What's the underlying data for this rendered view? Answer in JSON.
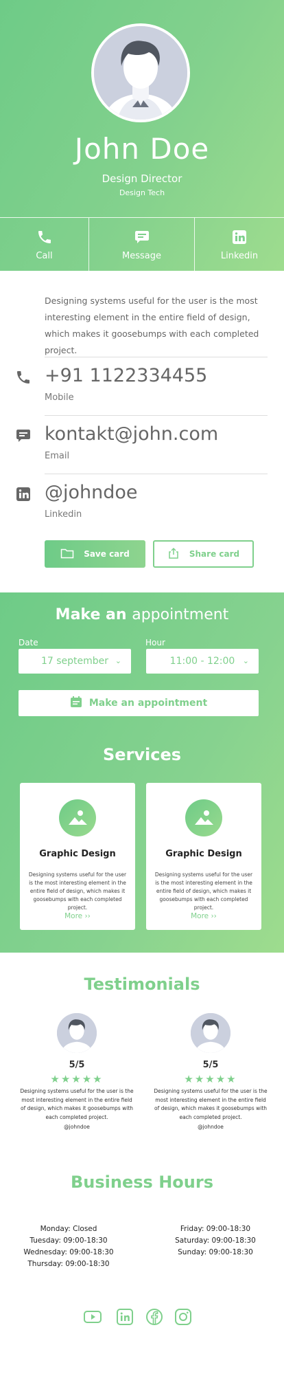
{
  "profile": {
    "name": "John Doe",
    "title": "Design Director",
    "company": "Design Tech"
  },
  "actions": [
    {
      "label": "Call",
      "icon": "phone-icon"
    },
    {
      "label": "Message",
      "icon": "message-icon"
    },
    {
      "label": "Linkedin",
      "icon": "linkedin-icon"
    }
  ],
  "about": "Designing systems useful for the user is the most interesting element in the entire field of design, which makes it goosebumps with each completed project.",
  "contacts": [
    {
      "value": "+91 1122334455",
      "label": "Mobile",
      "icon": "phone-icon"
    },
    {
      "value": "kontakt@john.com",
      "label": "Email",
      "icon": "message-icon"
    },
    {
      "value": "@johndoe",
      "label": "Linkedin",
      "icon": "linkedin-icon"
    }
  ],
  "card_buttons": {
    "save": "Save card",
    "share": "Share card"
  },
  "appointment": {
    "title_prefix": "Make an",
    "title_emph": "appointment",
    "date_label": "Date",
    "date_value": "17 september",
    "hour_label": "Hour",
    "hour_value": "11:00 - 12:00",
    "button": "Make an appointment"
  },
  "services": {
    "title": "Services",
    "items": [
      {
        "title": "Graphic Design",
        "desc": "Designing systems useful for the user is the most interesting element in the entire field of design, which makes it goosebumps with each completed project.",
        "more": "More ››"
      },
      {
        "title": "Graphic Design",
        "desc": "Designing systems useful for the user is the most interesting element in the entire field of design, which makes it goosebumps with each completed project.",
        "more": "More ››"
      }
    ]
  },
  "testimonials": {
    "title": "Testimonials",
    "items": [
      {
        "score": "5/5",
        "stars": "★★★★★",
        "text": "Designing systems useful for the user is the most interesting element in the entire field of design, which makes it goosebumps with each completed project.",
        "user": "@johndoe"
      },
      {
        "score": "5/5",
        "stars": "★★★★★",
        "text": "Designing systems useful for the user is the most interesting element in the entire field of design, which makes it goosebumps with each completed project.",
        "user": "@johndoe"
      }
    ]
  },
  "business_hours": {
    "title": "Business Hours",
    "left": [
      "Monday: Closed",
      "Tuesday: 09:00-18:30",
      "Wednesday: 09:00-18:30",
      "Thursday: 09:00-18:30"
    ],
    "right": [
      "Friday: 09:00-18:30",
      "Saturday: 09:00-18:30",
      "Sunday: 09:00-18:30"
    ]
  },
  "social": [
    "youtube-icon",
    "linkedin-icon",
    "facebook-icon",
    "instagram-icon"
  ],
  "colors": {
    "accent": "#7fd08c",
    "gradient_start": "#6ecb87",
    "gradient_end": "#9edc8e",
    "icon_gray": "#666666"
  }
}
